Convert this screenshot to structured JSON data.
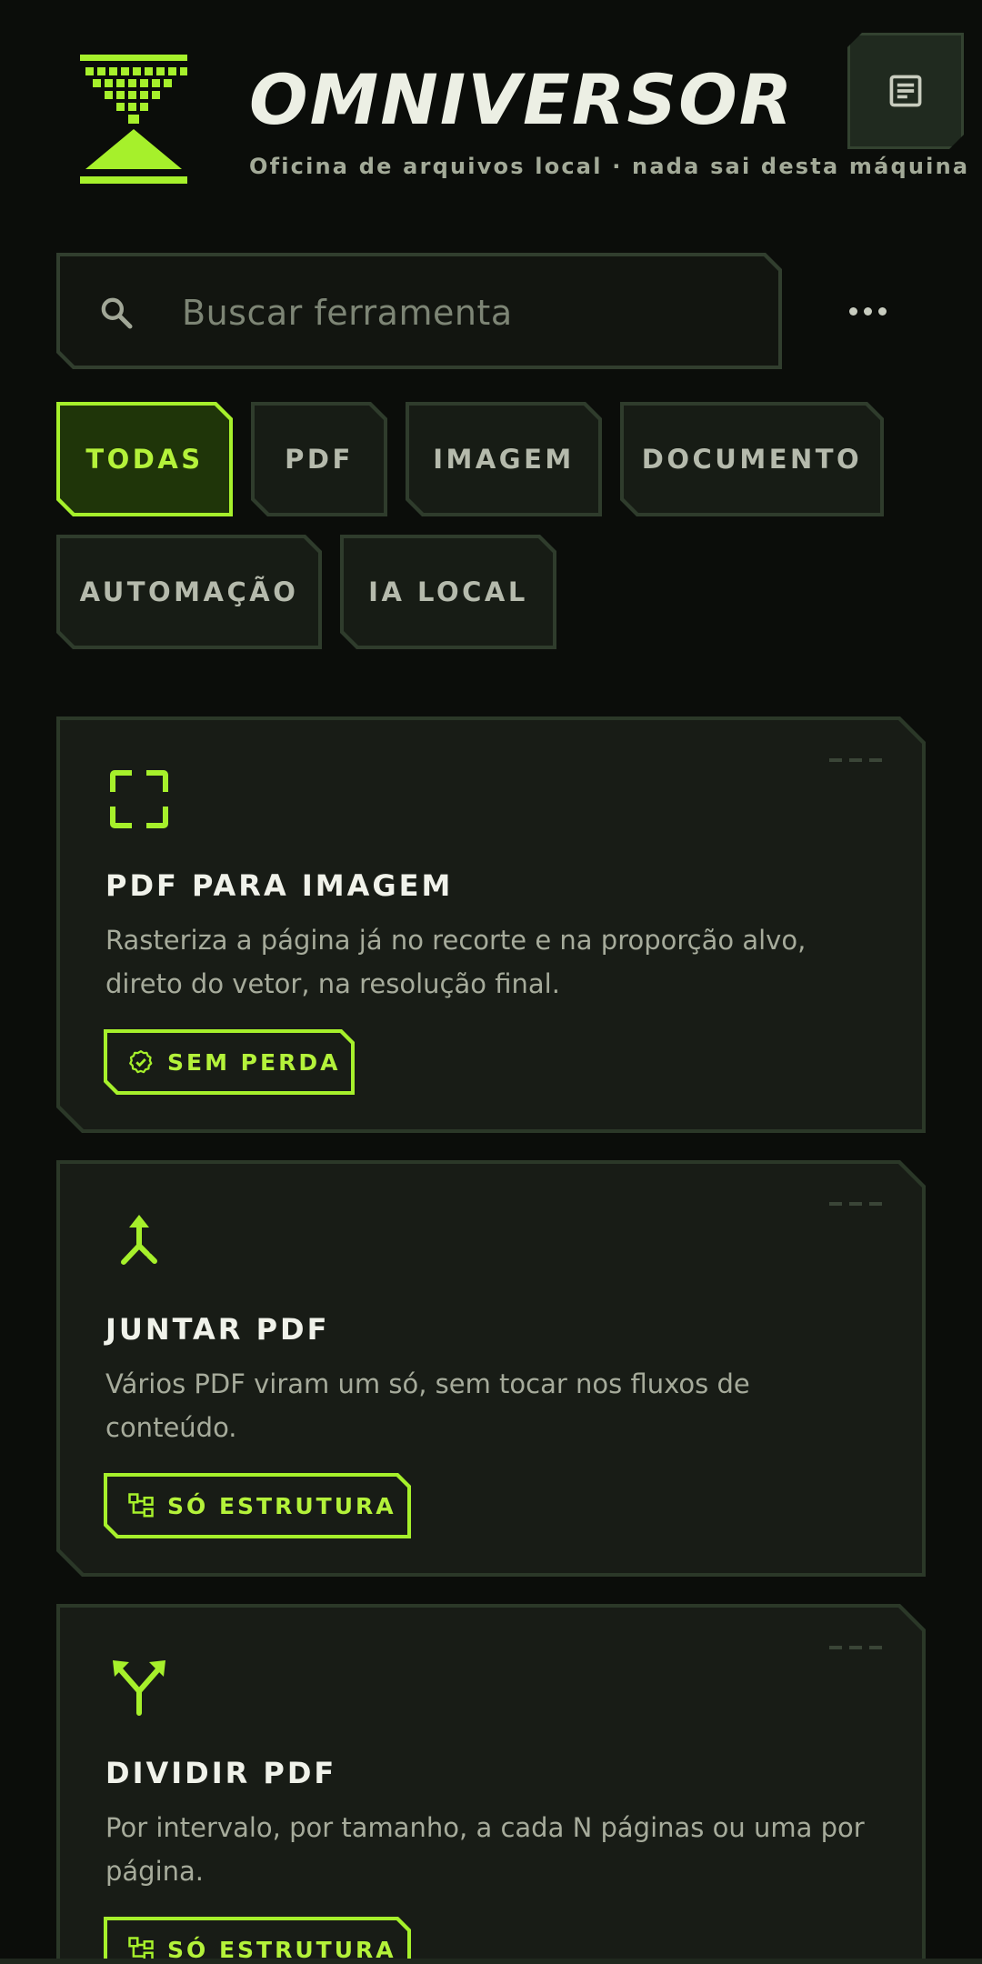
{
  "header": {
    "title": "OMNIVERSOR",
    "subtitle": "Oficina de arquivos local · nada sai desta máquina",
    "docs_icon": "document-icon",
    "logo_icon": "hourglass-logo"
  },
  "search": {
    "placeholder": "Buscar ferramenta",
    "icon": "search-icon"
  },
  "more_menu": {
    "icon": "more-horizontal-icon"
  },
  "filters": [
    {
      "label": "TODAS",
      "active": true
    },
    {
      "label": "PDF",
      "active": false
    },
    {
      "label": "IMAGEM",
      "active": false
    },
    {
      "label": "DOCUMENTO",
      "active": false
    },
    {
      "label": "AUTOMAÇÃO",
      "active": false
    },
    {
      "label": "IA LOCAL",
      "active": false
    }
  ],
  "tools": [
    {
      "icon": "fullscreen-crop-icon",
      "title": "PDF PARA IMAGEM",
      "description": "Rasteriza a página já no recorte e na proporção alvo, direto do vetor, na resolução final.",
      "badge": {
        "icon": "verified-check-icon",
        "label": "SEM PERDA"
      }
    },
    {
      "icon": "merge-icon",
      "title": "JUNTAR PDF",
      "description": "Vários PDF viram um só, sem tocar nos fluxos de conteúdo.",
      "badge": {
        "icon": "structure-tree-icon",
        "label": "SÓ ESTRUTURA"
      }
    },
    {
      "icon": "split-icon",
      "title": "DIVIDIR PDF",
      "description": "Por intervalo, por tamanho, a cada N páginas ou uma por página.",
      "badge": {
        "icon": "structure-tree-icon",
        "label": "SÓ ESTRUTURA"
      }
    }
  ],
  "colors": {
    "accent": "#a6f02b",
    "background": "#0b0d0a",
    "card": "#181c16",
    "border": "#2b3828"
  }
}
